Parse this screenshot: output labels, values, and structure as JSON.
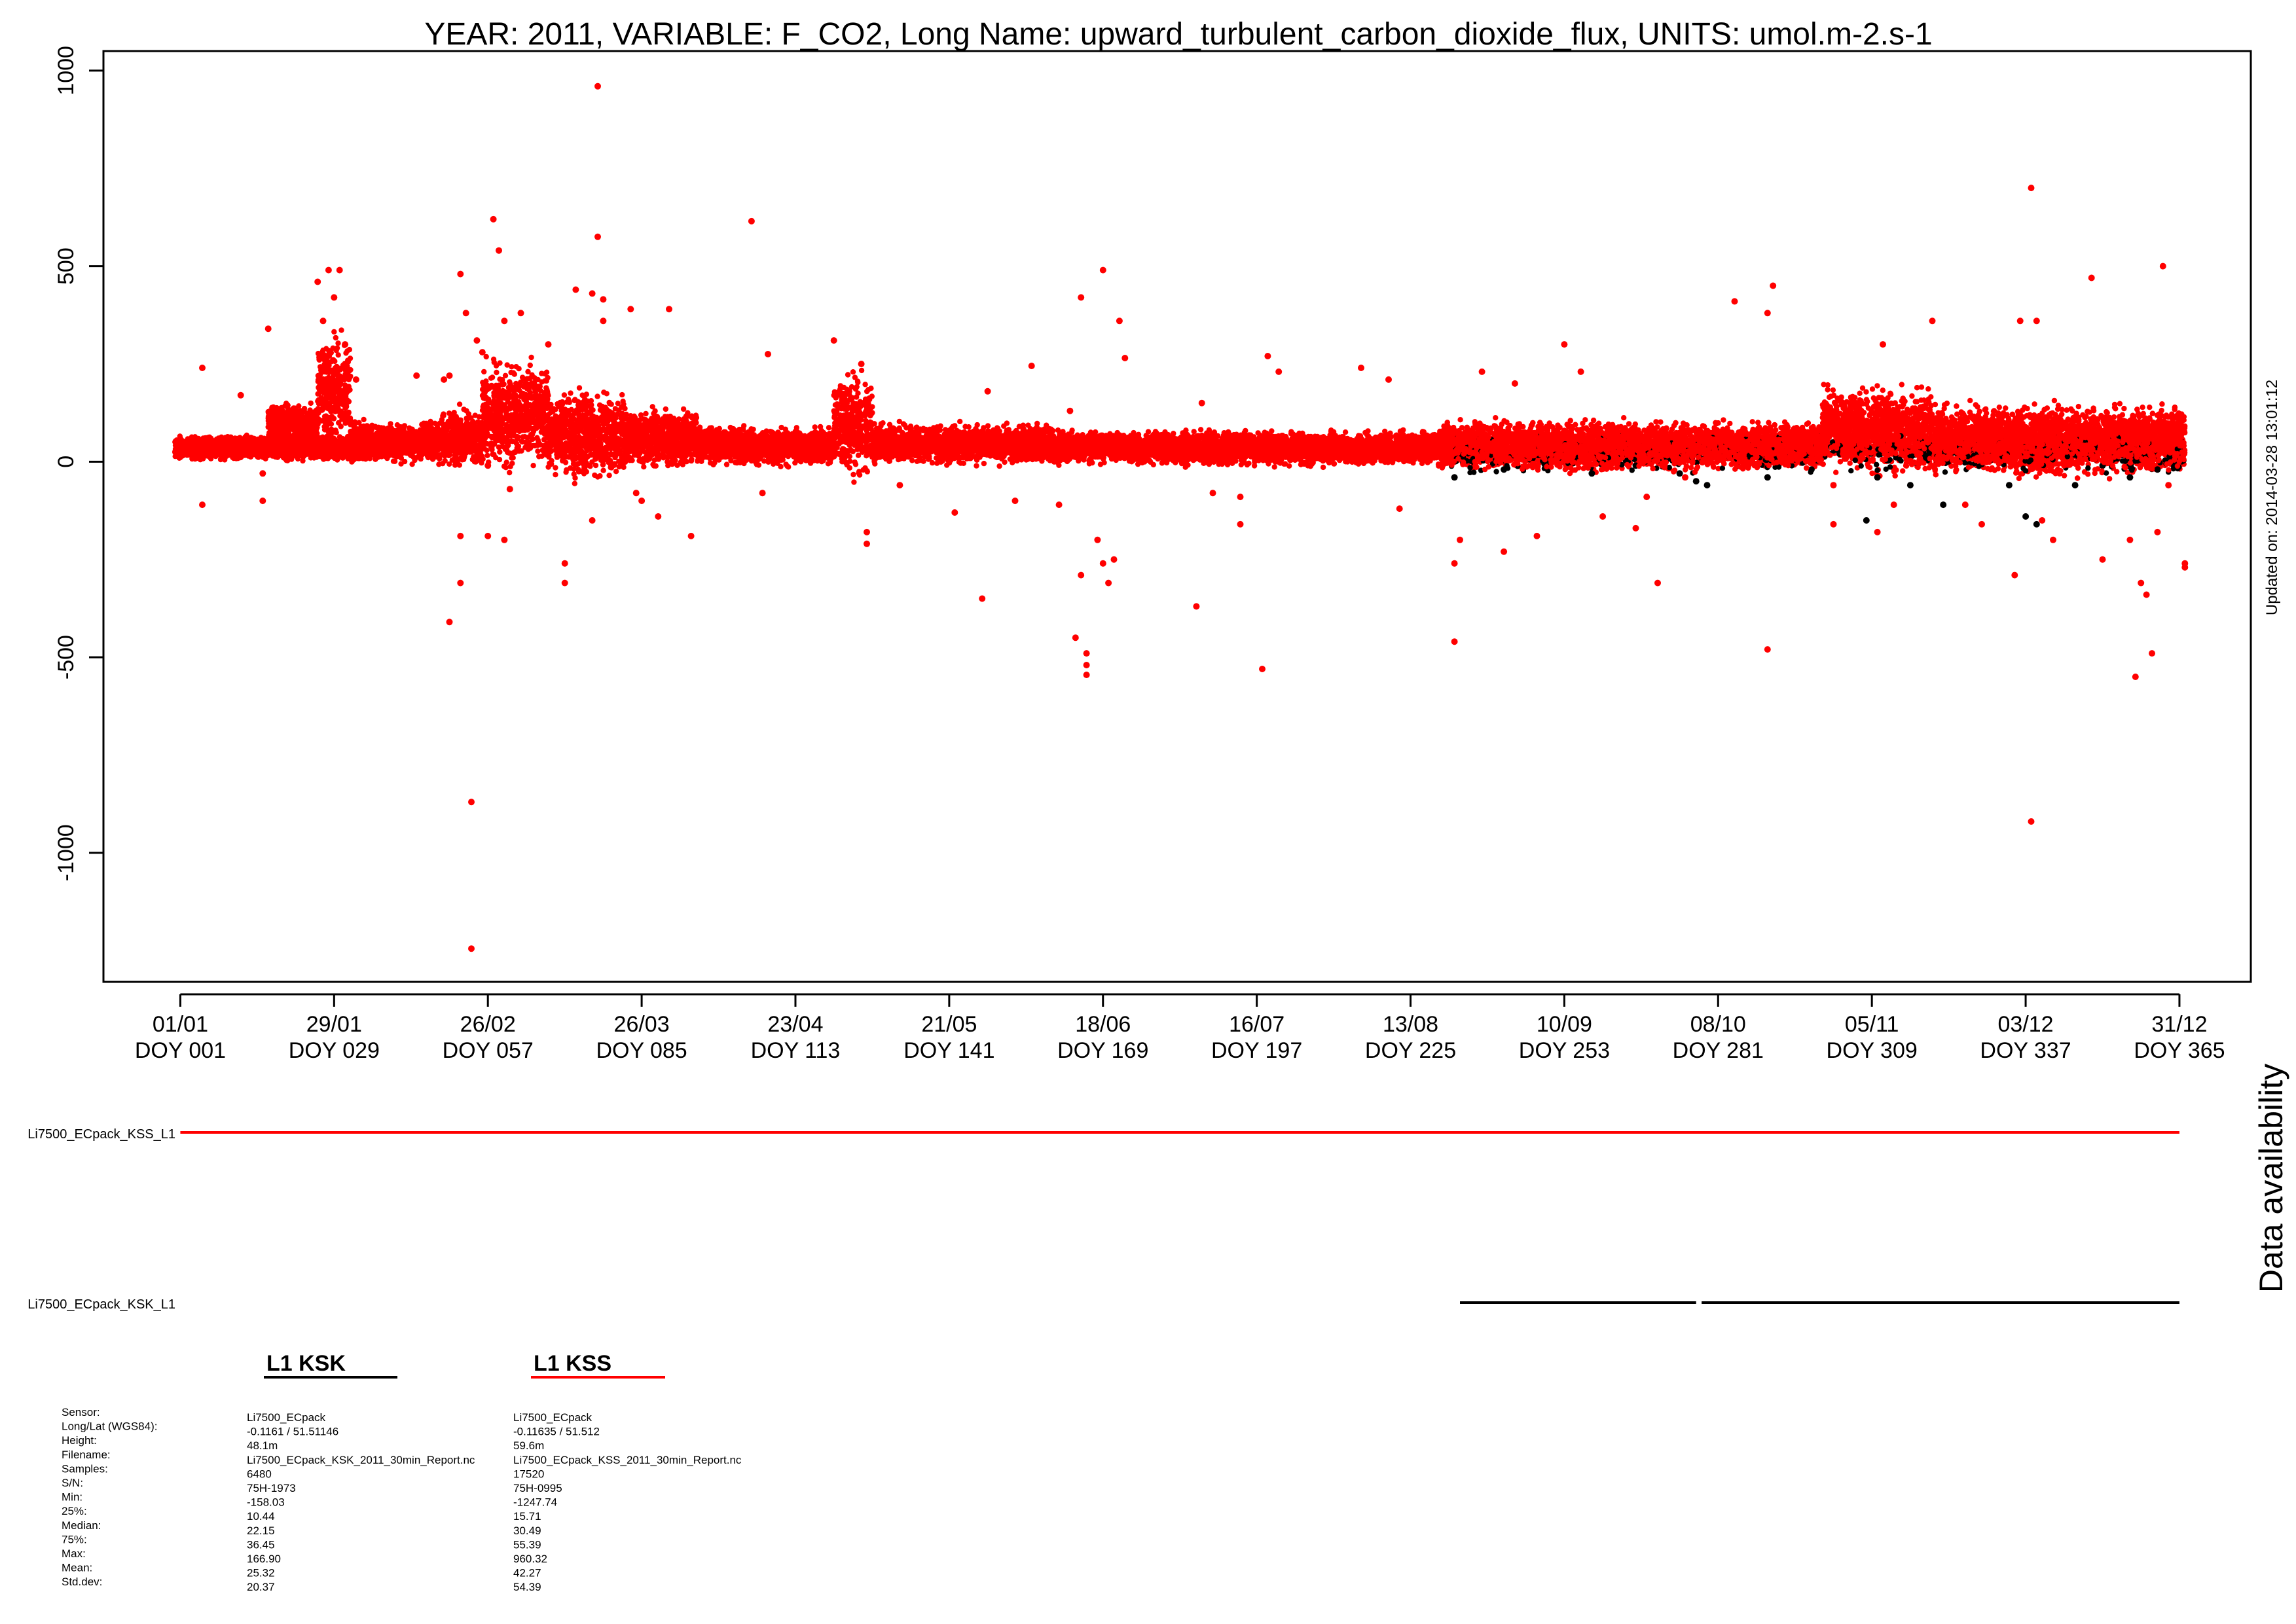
{
  "chart_data": {
    "type": "scatter",
    "title": "YEAR: 2011, VARIABLE: F_CO2, Long Name: upward_turbulent_carbon_dioxide_flux, UNITS: umol.m-2.s-1",
    "xlabel": "",
    "ylabel": "",
    "xlim": [
      -13,
      378
    ],
    "ylim": [
      -1330,
      1050
    ],
    "y_ticks": [
      {
        "value": 1000,
        "label": "1000"
      },
      {
        "value": 500,
        "label": "500"
      },
      {
        "value": 0,
        "label": "0"
      },
      {
        "value": -500,
        "label": "-500"
      },
      {
        "value": -1000,
        "label": "-1000"
      }
    ],
    "x_ticks": [
      {
        "value": 1,
        "date": "01/01",
        "doy": "DOY 001"
      },
      {
        "value": 29,
        "date": "29/01",
        "doy": "DOY 029"
      },
      {
        "value": 57,
        "date": "26/02",
        "doy": "DOY 057"
      },
      {
        "value": 85,
        "date": "26/03",
        "doy": "DOY 085"
      },
      {
        "value": 113,
        "date": "23/04",
        "doy": "DOY 113"
      },
      {
        "value": 141,
        "date": "21/05",
        "doy": "DOY 141"
      },
      {
        "value": 169,
        "date": "18/06",
        "doy": "DOY 169"
      },
      {
        "value": 197,
        "date": "16/07",
        "doy": "DOY 197"
      },
      {
        "value": 225,
        "date": "13/08",
        "doy": "DOY 225"
      },
      {
        "value": 253,
        "date": "10/09",
        "doy": "DOY 253"
      },
      {
        "value": 281,
        "date": "08/10",
        "doy": "DOY 281"
      },
      {
        "value": 309,
        "date": "05/11",
        "doy": "DOY 309"
      },
      {
        "value": 337,
        "date": "03/12",
        "doy": "DOY 337"
      },
      {
        "value": 365,
        "date": "31/12",
        "doy": "DOY 365"
      }
    ],
    "grid": false,
    "series": [
      {
        "name": "L1 KSS",
        "color": "#ff0000",
        "points": [
          [
            5,
            240
          ],
          [
            5,
            -110
          ],
          [
            12,
            170
          ],
          [
            16,
            -30
          ],
          [
            17,
            340
          ],
          [
            16,
            -100
          ],
          [
            26,
            460
          ],
          [
            27,
            360
          ],
          [
            28,
            490
          ],
          [
            29,
            420
          ],
          [
            30,
            490
          ],
          [
            31,
            300
          ],
          [
            31,
            250
          ],
          [
            33,
            210
          ],
          [
            44,
            220
          ],
          [
            49,
            210
          ],
          [
            50,
            220
          ],
          [
            55,
            310
          ],
          [
            56,
            280
          ],
          [
            57,
            -10
          ],
          [
            50,
            -410
          ],
          [
            52,
            480
          ],
          [
            52,
            -310
          ],
          [
            53,
            380
          ],
          [
            52,
            -190
          ],
          [
            54,
            -870
          ],
          [
            54,
            -1245
          ],
          [
            57,
            -190
          ],
          [
            58,
            620
          ],
          [
            59,
            540
          ],
          [
            60,
            -200
          ],
          [
            63,
            380
          ],
          [
            60,
            360
          ],
          [
            61,
            -70
          ],
          [
            68,
            300
          ],
          [
            71,
            -310
          ],
          [
            71,
            -260
          ],
          [
            73,
            440
          ],
          [
            76,
            430
          ],
          [
            77,
            960
          ],
          [
            77,
            575
          ],
          [
            78,
            415
          ],
          [
            78,
            360
          ],
          [
            76,
            -150
          ],
          [
            83,
            390
          ],
          [
            84,
            -80
          ],
          [
            85,
            -100
          ],
          [
            88,
            -140
          ],
          [
            90,
            390
          ],
          [
            94,
            -190
          ],
          [
            105,
            615
          ],
          [
            108,
            275
          ],
          [
            107,
            -80
          ],
          [
            120,
            310
          ],
          [
            125,
            250
          ],
          [
            126,
            -180
          ],
          [
            126,
            -210
          ],
          [
            132,
            -60
          ],
          [
            142,
            -130
          ],
          [
            147,
            -350
          ],
          [
            148,
            180
          ],
          [
            153,
            -100
          ],
          [
            156,
            245
          ],
          [
            161,
            -110
          ],
          [
            163,
            130
          ],
          [
            164,
            -450
          ],
          [
            165,
            420
          ],
          [
            165,
            -290
          ],
          [
            166,
            -490
          ],
          [
            166,
            -545
          ],
          [
            166,
            -520
          ],
          [
            168,
            -200
          ],
          [
            169,
            490
          ],
          [
            169,
            -260
          ],
          [
            170,
            -310
          ],
          [
            172,
            360
          ],
          [
            171,
            -250
          ],
          [
            173,
            265
          ],
          [
            186,
            -370
          ],
          [
            187,
            150
          ],
          [
            189,
            -80
          ],
          [
            194,
            -160
          ],
          [
            194,
            -90
          ],
          [
            198,
            -530
          ],
          [
            199,
            270
          ],
          [
            201,
            230
          ],
          [
            216,
            240
          ],
          [
            221,
            210
          ],
          [
            223,
            -120
          ],
          [
            234,
            -200
          ],
          [
            233,
            -460
          ],
          [
            233,
            -260
          ],
          [
            238,
            230
          ],
          [
            242,
            -230
          ],
          [
            244,
            200
          ],
          [
            248,
            -190
          ],
          [
            253,
            300
          ],
          [
            256,
            230
          ],
          [
            260,
            -140
          ],
          [
            270,
            -310
          ],
          [
            266,
            -170
          ],
          [
            268,
            -90
          ],
          [
            275,
            -40
          ],
          [
            284,
            410
          ],
          [
            290,
            -480
          ],
          [
            290,
            380
          ],
          [
            291,
            450
          ],
          [
            302,
            -160
          ],
          [
            302,
            -60
          ],
          [
            310,
            -180
          ],
          [
            311,
            300
          ],
          [
            313,
            -110
          ],
          [
            320,
            360
          ],
          [
            326,
            -110
          ],
          [
            329,
            -160
          ],
          [
            335,
            -290
          ],
          [
            336,
            360
          ],
          [
            338,
            -920
          ],
          [
            338,
            700
          ],
          [
            339,
            360
          ],
          [
            340,
            -150
          ],
          [
            342,
            -200
          ],
          [
            349,
            470
          ],
          [
            351,
            -250
          ],
          [
            356,
            -200
          ],
          [
            357,
            -550
          ],
          [
            359,
            -340
          ],
          [
            360,
            -490
          ],
          [
            362,
            500
          ],
          [
            361,
            -180
          ],
          [
            363,
            -60
          ],
          [
            366,
            -270
          ],
          [
            366,
            -260
          ],
          [
            358,
            -310
          ]
        ]
      },
      {
        "name": "L1 KSK",
        "color": "#000000",
        "points": [
          [
            233,
            -40
          ],
          [
            242,
            -20
          ],
          [
            258,
            -30
          ],
          [
            266,
            -10
          ],
          [
            270,
            40
          ],
          [
            274,
            -30
          ],
          [
            277,
            -50
          ],
          [
            279,
            -60
          ],
          [
            290,
            -40
          ],
          [
            298,
            -20
          ],
          [
            308,
            -150
          ],
          [
            310,
            -40
          ],
          [
            316,
            -60
          ],
          [
            322,
            -110
          ],
          [
            334,
            -60
          ],
          [
            337,
            -140
          ],
          [
            339,
            -160
          ],
          [
            346,
            -60
          ],
          [
            351,
            -10
          ],
          [
            356,
            -40
          ],
          [
            361,
            -20
          ],
          [
            364,
            -10
          ]
        ]
      }
    ],
    "bands": [
      {
        "start": 0,
        "end": 38,
        "center": 35,
        "width": 25
      },
      {
        "start": 17,
        "end": 26,
        "center": 95,
        "width": 45
      },
      {
        "start": 26,
        "end": 32,
        "center": 180,
        "width": 120
      },
      {
        "start": 32,
        "end": 48,
        "center": 50,
        "width": 40
      },
      {
        "start": 48,
        "end": 56,
        "center": 60,
        "width": 60
      },
      {
        "start": 56,
        "end": 68,
        "center": 120,
        "width": 110
      },
      {
        "start": 68,
        "end": 82,
        "center": 70,
        "width": 90
      },
      {
        "start": 82,
        "end": 95,
        "center": 60,
        "width": 60
      },
      {
        "start": 95,
        "end": 120,
        "center": 40,
        "width": 40
      },
      {
        "start": 120,
        "end": 127,
        "center": 90,
        "width": 110
      },
      {
        "start": 127,
        "end": 160,
        "center": 45,
        "width": 40
      },
      {
        "start": 160,
        "end": 230,
        "center": 35,
        "width": 35
      },
      {
        "start": 230,
        "end": 300,
        "center": 40,
        "width": 50
      },
      {
        "start": 300,
        "end": 320,
        "center": 80,
        "width": 90
      },
      {
        "start": 320,
        "end": 366,
        "center": 55,
        "width": 70
      }
    ],
    "ksk_band": {
      "start": 232,
      "end": 366,
      "center": 20,
      "width": 50
    },
    "legend": "none"
  },
  "side_label": "Updated on: 2014-03-28 13:01:12",
  "availability": {
    "title": "Data availability",
    "rows": [
      {
        "label": "Li7500_ECpack_KSS_L1",
        "color": "#ff0000",
        "segments": [
          [
            1,
            365
          ]
        ]
      },
      {
        "label": "Li7500_ECpack_KSK_L1",
        "color": "#000000",
        "segments": [
          [
            234,
            277
          ],
          [
            278,
            365
          ]
        ]
      }
    ]
  },
  "info": {
    "headers": [
      {
        "label": "L1 KSK",
        "color": "#000000"
      },
      {
        "label": "L1 KSS",
        "color": "#ff0000"
      }
    ],
    "fields": [
      "Sensor:",
      "Long/Lat (WGS84):",
      "Height:",
      "Filename:",
      "Samples:",
      "S/N:",
      "Min:",
      "25%:",
      "Median:",
      "75%:",
      "Max:",
      "Mean:",
      "Std.dev:"
    ],
    "ksk": [
      "Li7500_ECpack",
      "-0.1161 / 51.51146",
      "48.1m",
      "Li7500_ECpack_KSK_2011_30min_Report.nc",
      "6480",
      "75H-1973",
      "-158.03",
      "10.44",
      "22.15",
      "36.45",
      "166.90",
      "25.32",
      "20.37"
    ],
    "kss": [
      "Li7500_ECpack",
      "-0.11635 / 51.512",
      "59.6m",
      "Li7500_ECpack_KSS_2011_30min_Report.nc",
      "17520",
      "75H-0995",
      "-1247.74",
      "15.71",
      "30.49",
      "55.39",
      "960.32",
      "42.27",
      "54.39"
    ]
  }
}
